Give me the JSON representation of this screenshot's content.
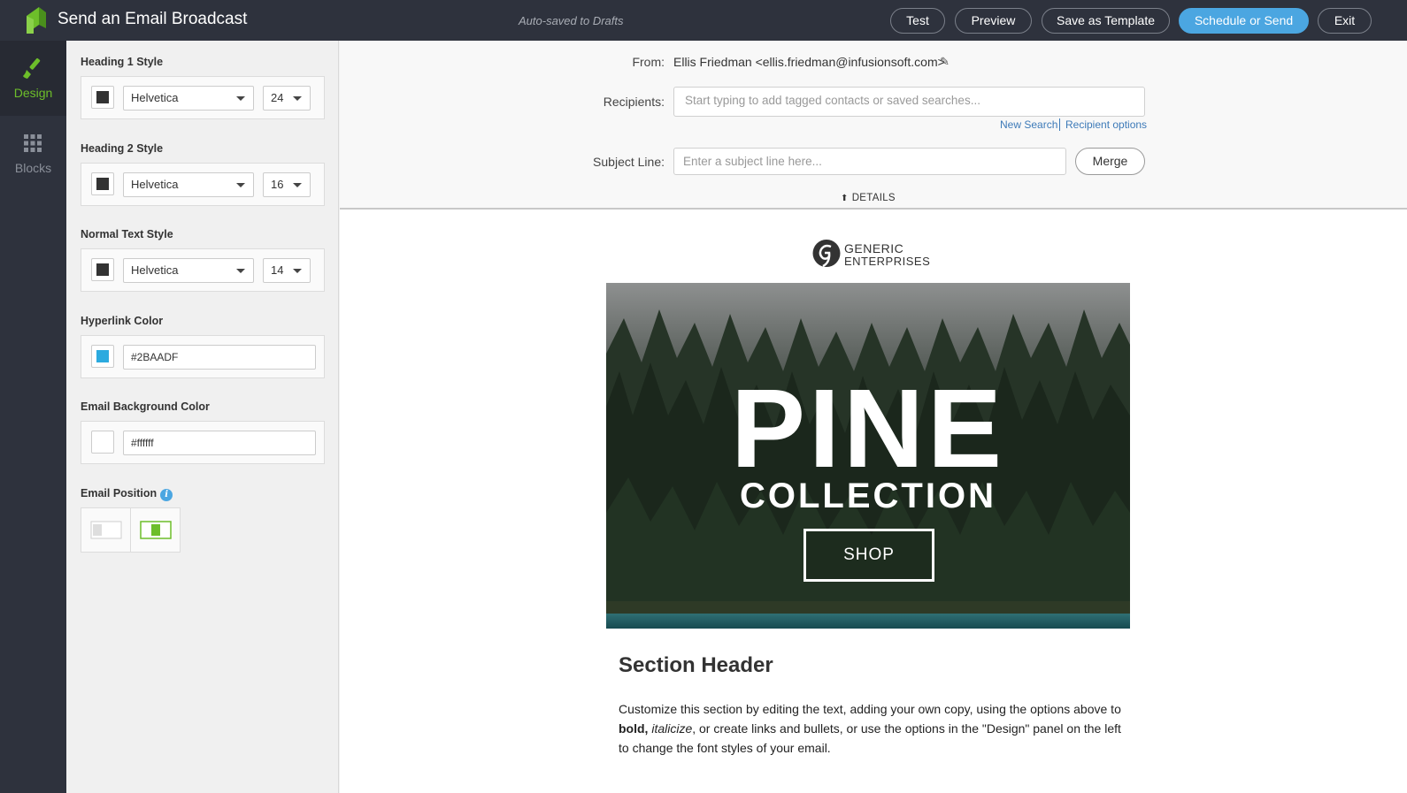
{
  "header": {
    "title": "Send an Email Broadcast",
    "autosave": "Auto-saved to Drafts",
    "buttons": {
      "test": "Test",
      "preview": "Preview",
      "save_template": "Save as Template",
      "schedule_send": "Schedule or Send",
      "exit": "Exit"
    },
    "accent_color": "#4BA6E1"
  },
  "rail": {
    "design": "Design",
    "blocks": "Blocks",
    "active": "design",
    "active_color": "#6DBE2A"
  },
  "panel": {
    "h1": {
      "title": "Heading 1 Style",
      "font": "Helvetica",
      "size": "24",
      "color": "#333333"
    },
    "h2": {
      "title": "Heading 2 Style",
      "font": "Helvetica",
      "size": "16",
      "color": "#333333"
    },
    "normal": {
      "title": "Normal Text Style",
      "font": "Helvetica",
      "size": "14",
      "color": "#333333"
    },
    "hyperlink": {
      "title": "Hyperlink Color",
      "value": "#2BAADF"
    },
    "background": {
      "title": "Email Background Color",
      "value": "#ffffff"
    },
    "position": {
      "title": "Email Position",
      "selected": "center"
    }
  },
  "fields": {
    "from_label": "From:",
    "from_value": "Ellis Friedman <ellis.friedman@infusionsoft.com>",
    "recipients_label": "Recipients:",
    "recipients_placeholder": "Start typing to add tagged contacts or saved searches...",
    "new_search": "New Search",
    "recipient_options": "Recipient options",
    "subject_label": "Subject Line:",
    "subject_placeholder": "Enter a subject line here...",
    "merge": "Merge",
    "details": "DETAILS"
  },
  "email": {
    "brand_line1": "GENERIC",
    "brand_line2": "ENTERPRISES",
    "hero_title": "PINE",
    "hero_subtitle": "COLLECTION",
    "hero_button": "SHOP",
    "section_header": "Section Header",
    "body_part1": "Customize this section by editing the text, adding your own copy, using the options above to ",
    "body_bold": "bold,",
    "body_italic": "italicize",
    "body_part2": ", or create links and bullets, or use the options in the \"Design\" panel on the left to change the font styles of your email."
  }
}
